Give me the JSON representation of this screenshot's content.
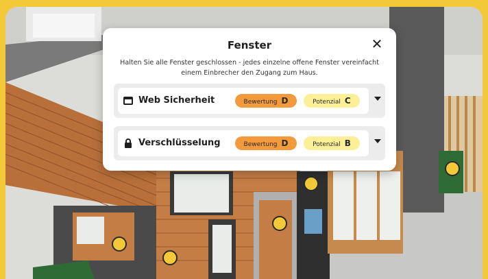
{
  "modal": {
    "title": "Fenster",
    "close_label": "✕",
    "description": "Halten Sie alle Fenster geschlossen - jedes einzelne offene Fenster vereinfacht einem Einbrecher den Zugang zum Haus."
  },
  "rows": [
    {
      "icon": "window-icon",
      "label": "Web Sicherheit",
      "rating_label": "Bewertung",
      "rating_value": "D",
      "potential_label": "Potenzial",
      "potential_value": "C"
    },
    {
      "icon": "lock-icon",
      "label": "Verschlüsselung",
      "rating_label": "Bewertung",
      "rating_value": "D",
      "potential_label": "Potenzial",
      "potential_value": "B"
    }
  ],
  "colors": {
    "frame": "#f3c93a",
    "rating_pill": "#f39a3c",
    "potential_pill": "#fbf097",
    "row_bg": "#ececec"
  }
}
